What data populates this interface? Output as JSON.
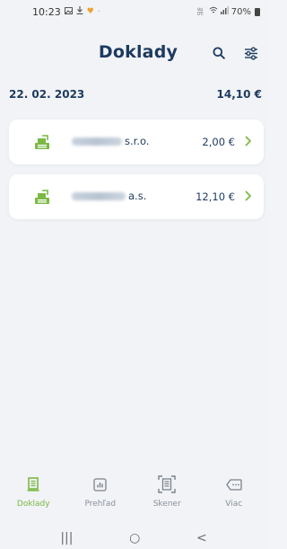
{
  "status_bar": {
    "time": "10:23",
    "right_text": "70%",
    "network_label": "Vo) LTE"
  },
  "header": {
    "title": "Doklady",
    "search_icon": "search-icon",
    "filter_icon": "sliders-icon"
  },
  "date_group": {
    "date": "22. 02. 2023",
    "total": "14,10 €"
  },
  "receipts": [
    {
      "merchant_suffix": "s.r.o.",
      "amount": "2,00 €",
      "icon": "receipt-stack-icon"
    },
    {
      "merchant_suffix": "a.s.",
      "amount": "12,10 €",
      "icon": "receipt-stack-icon"
    }
  ],
  "bottom_nav": [
    {
      "label": "Doklady",
      "icon": "receipt-icon",
      "active": true
    },
    {
      "label": "Prehľad",
      "icon": "chart-icon",
      "active": false
    },
    {
      "label": "Skener",
      "icon": "scanner-icon",
      "active": false
    },
    {
      "label": "Viac",
      "icon": "more-icon",
      "active": false
    }
  ],
  "system_nav": {
    "recent": "|||",
    "home": "○",
    "back": "<"
  },
  "colors": {
    "accent": "#7bb944",
    "title": "#1d3a5f",
    "background": "#f1f3f6"
  }
}
